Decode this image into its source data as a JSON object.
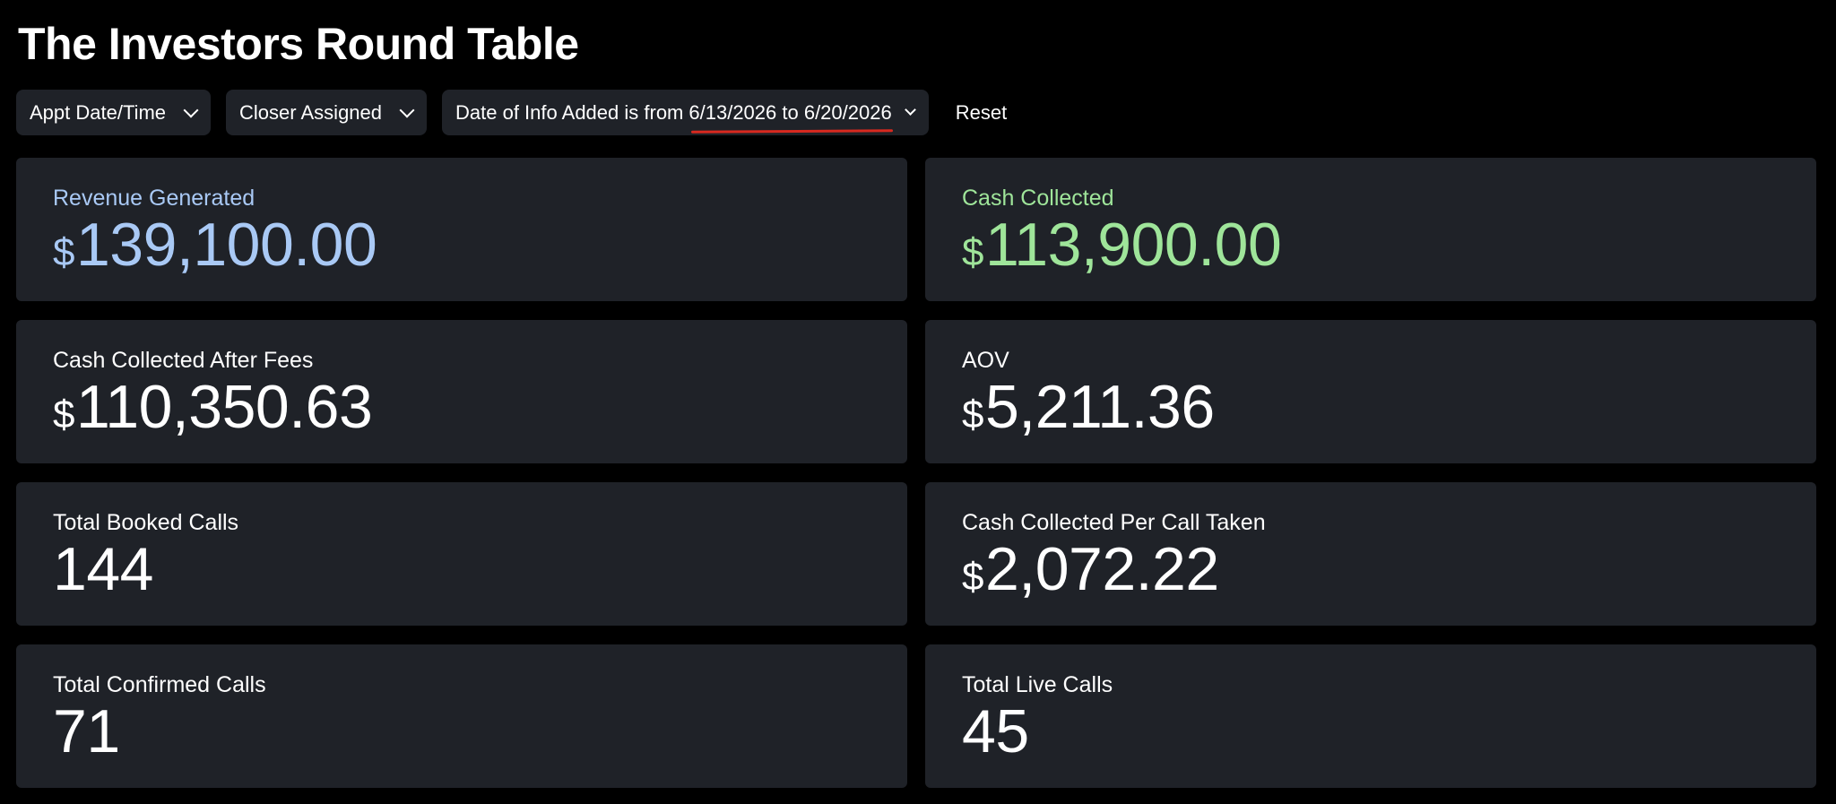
{
  "header": {
    "title": "The Investors Round Table"
  },
  "filters": {
    "appt": {
      "label": "Appt Date/Time"
    },
    "closer": {
      "label": "Closer Assigned"
    },
    "date_info": {
      "prefix": "Date of Info Added is from",
      "range": "6/13/2026 to 6/20/2026"
    },
    "reset_label": "Reset"
  },
  "metrics": {
    "revenue": {
      "label": "Revenue Generated",
      "currency": "$",
      "value": "139,100.00",
      "color": "#a9c9f5"
    },
    "cash_collected": {
      "label": "Cash Collected",
      "currency": "$",
      "value": "113,900.00",
      "color": "#9fe59a"
    },
    "cash_after_fees": {
      "label": "Cash Collected After Fees",
      "currency": "$",
      "value": "110,350.63"
    },
    "aov": {
      "label": "AOV",
      "currency": "$",
      "value": "5,211.36"
    },
    "booked_calls": {
      "label": "Total Booked Calls",
      "value": "144"
    },
    "cash_per_call": {
      "label": "Cash Collected Per Call Taken",
      "currency": "$",
      "value": "2,072.22"
    },
    "confirmed_calls": {
      "label": "Total Confirmed Calls",
      "value": "71"
    },
    "live_calls": {
      "label": "Total Live Calls",
      "value": "45"
    }
  },
  "colors": {
    "background": "#000000",
    "card": "#1f2228",
    "accent_blue": "#a9c9f5",
    "accent_green": "#9fe59a",
    "underline_red": "#d8291f"
  },
  "icons": {
    "dropdown": "chevron-down-icon"
  }
}
